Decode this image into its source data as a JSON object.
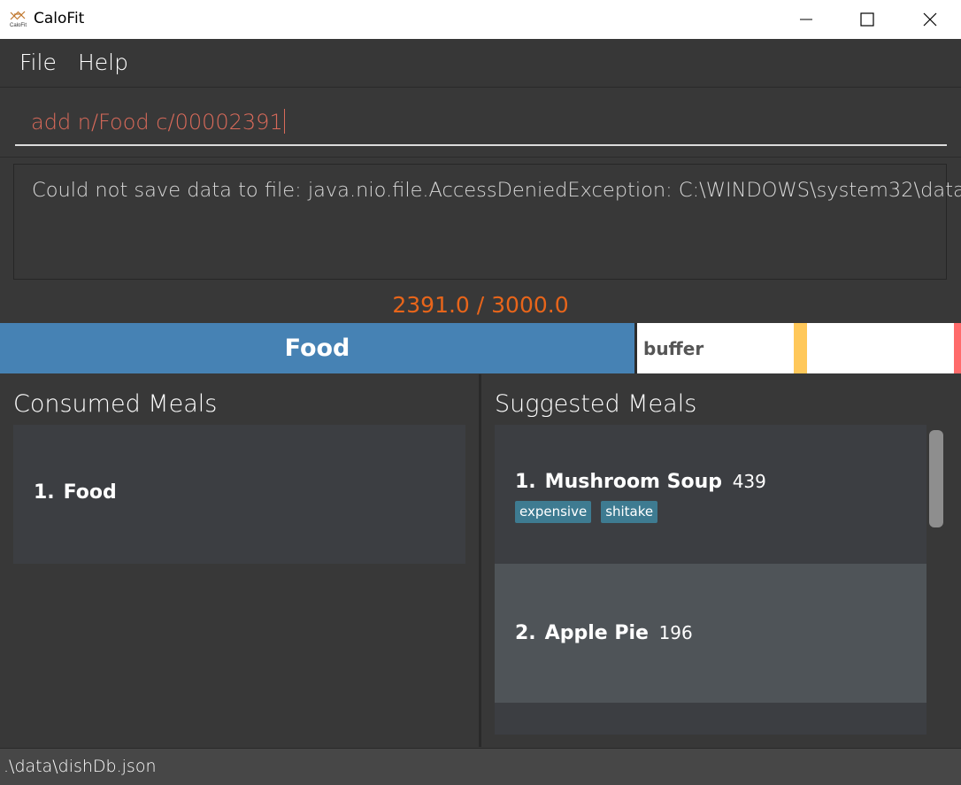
{
  "window": {
    "title": "CaloFit",
    "icon": "calofit-logo-icon"
  },
  "menu": {
    "items": [
      "File",
      "Help"
    ]
  },
  "command": {
    "value": "add n/Food c/00002391"
  },
  "result": {
    "message": "Could not save data to file: java.nio.file.AccessDeniedException: C:\\WINDOWS\\system32\\data"
  },
  "calories": {
    "consumed": 2391.0,
    "budget": 3000.0,
    "display": "2391.0 / 3000.0",
    "fill_fraction": 0.66
  },
  "progress": {
    "fill_label": "Food",
    "buffer_label": "buffer"
  },
  "consumed": {
    "title": "Consumed Meals",
    "items": [
      {
        "index": "1.",
        "name": "Food"
      }
    ]
  },
  "suggested": {
    "title": "Suggested Meals",
    "items": [
      {
        "index": "1.",
        "name": "Mushroom Soup",
        "calories": "439",
        "tags": [
          "expensive",
          "shitake"
        ]
      },
      {
        "index": "2.",
        "name": "Apple Pie",
        "calories": "196",
        "tags": []
      }
    ]
  },
  "status": {
    "path": ".\\data\\dishDb.json"
  },
  "colors": {
    "accent_blue": "#4682b4",
    "calorie_orange": "#e8651a",
    "command_red": "#d96a5a",
    "tag_teal": "#3e7b91",
    "buffer_yellow": "#ffc85a",
    "limit_red": "#ff6b6b"
  }
}
